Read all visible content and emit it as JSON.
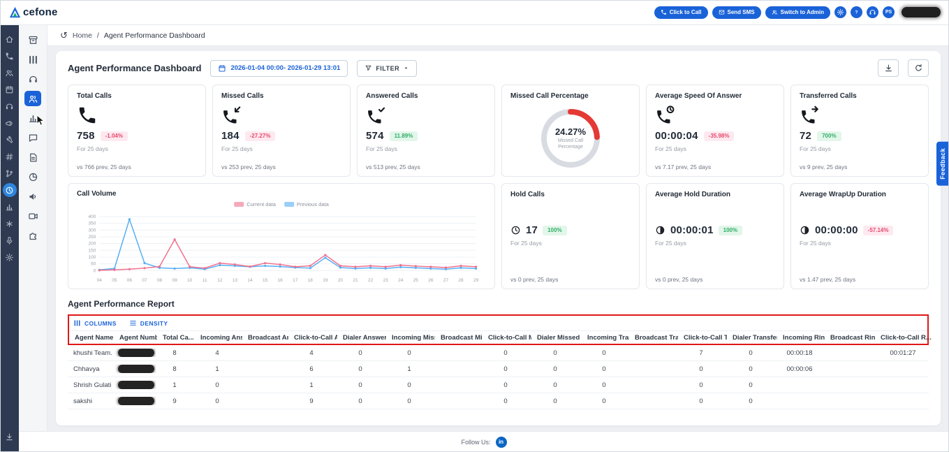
{
  "colors": {
    "accent_blue": "#1a62d8",
    "sidebar_dark": "#2d3a51",
    "positive_text": "#2fae68",
    "positive_bg": "#e2f6ea",
    "negative_text": "#e8486e",
    "negative_bg": "#fde9ef",
    "gauge_red": "#e53935",
    "gauge_track": "#d8dce2",
    "annotation_box": "#e01818",
    "linkedin_blue": "#0a66c2"
  },
  "topbar": {
    "logo_text": "cefone",
    "buttons": [
      {
        "name": "click-to-call",
        "label": "Click to Call",
        "icon": "phone"
      },
      {
        "name": "send-sms",
        "label": "Send SMS",
        "icon": "envelope"
      },
      {
        "name": "switch-to-admin",
        "label": "Switch to Admin",
        "icon": "users"
      }
    ],
    "icon_buttons": [
      {
        "name": "settings",
        "icon": "gear"
      },
      {
        "name": "help",
        "icon": "question"
      },
      {
        "name": "support-agent",
        "icon": "headset"
      }
    ],
    "avatar_initials": "PS",
    "redacted_info": true
  },
  "breadcrumb": {
    "items": [
      "Home",
      "Agent Performance Dashboard"
    ],
    "separator": "/"
  },
  "toolbar": {
    "title": "Agent Performance Dashboard",
    "date_range": "2026-01-04 00:00- 2026-01-29 13:01",
    "filter_label": "FILTER"
  },
  "sidebar_primary": {
    "items": [
      {
        "name": "home",
        "icon": "home"
      },
      {
        "name": "calls",
        "icon": "phone"
      },
      {
        "name": "contacts",
        "icon": "users"
      },
      {
        "name": "calendar",
        "icon": "calendar"
      },
      {
        "name": "call-center",
        "icon": "headset"
      },
      {
        "name": "campaigns",
        "icon": "megaphone"
      },
      {
        "name": "tools",
        "icon": "wrench"
      },
      {
        "name": "numbers",
        "icon": "hash"
      },
      {
        "name": "integrations",
        "icon": "branch"
      },
      {
        "name": "history",
        "icon": "history",
        "active": true
      },
      {
        "name": "analytics",
        "icon": "chart"
      },
      {
        "name": "services",
        "icon": "asterisk"
      },
      {
        "name": "recordings",
        "icon": "mic"
      },
      {
        "name": "settings",
        "icon": "gear"
      }
    ],
    "bottom": {
      "name": "download",
      "icon": "download"
    }
  },
  "sidebar_secondary": {
    "items": [
      {
        "name": "inbox",
        "icon": "archive"
      },
      {
        "name": "dashboard",
        "icon": "columns"
      },
      {
        "name": "calls",
        "icon": "headset"
      },
      {
        "name": "agents",
        "icon": "users",
        "active": true
      },
      {
        "name": "reports",
        "icon": "chart"
      },
      {
        "name": "chat",
        "icon": "chat"
      },
      {
        "name": "documents",
        "icon": "doc"
      },
      {
        "name": "analytics",
        "icon": "pie"
      },
      {
        "name": "announcements",
        "icon": "speaker"
      },
      {
        "name": "video",
        "icon": "camera"
      },
      {
        "name": "integrations",
        "icon": "puzzle"
      }
    ]
  },
  "kpis": [
    {
      "title": "Total Calls",
      "icon": "phone",
      "value": "758",
      "badge": "-1.04%",
      "badge_type": "negative",
      "period": "For 25 days",
      "comparison": "vs 766 prev, 25 days"
    },
    {
      "title": "Missed Calls",
      "icon": "phone-missed",
      "value": "184",
      "badge": "-27.27%",
      "badge_type": "negative",
      "period": "For 25 days",
      "comparison": "vs 253 prev, 25 days"
    },
    {
      "title": "Answered Calls",
      "icon": "phone-answered",
      "value": "574",
      "badge": "11.89%",
      "badge_type": "positive",
      "period": "For 25 days",
      "comparison": "vs 513 prev, 25 days"
    },
    {
      "type": "gauge",
      "title": "Missed Call Percentage",
      "value": "24.27%",
      "gauge_percent": 24.27,
      "label_lines": [
        "Missed Call",
        "Percentage"
      ]
    },
    {
      "title": "Average Speed Of Answer",
      "icon": "phone-clock",
      "value": "00:00:04",
      "badge": "-35.98%",
      "badge_type": "negative",
      "period": "For 25 days",
      "comparison": "vs 7.17 prev, 25 days"
    },
    {
      "title": "Transferred Calls",
      "icon": "phone-forward",
      "value": "72",
      "badge": "700%",
      "badge_type": "positive",
      "period": "For 25 days",
      "comparison": "vs 9 prev, 25 days"
    }
  ],
  "chart_data": {
    "type": "line",
    "title": "Call Volume",
    "x": [
      "04",
      "05",
      "06",
      "07",
      "08",
      "09",
      "10",
      "11",
      "12",
      "13",
      "14",
      "15",
      "16",
      "17",
      "18",
      "19",
      "20",
      "21",
      "22",
      "23",
      "24",
      "25",
      "26",
      "27",
      "28",
      "29"
    ],
    "series": [
      {
        "name": "Current data",
        "color": "#f0708d",
        "values": [
          2,
          5,
          10,
          18,
          30,
          230,
          28,
          18,
          55,
          45,
          30,
          55,
          45,
          28,
          35,
          115,
          35,
          28,
          35,
          28,
          40,
          33,
          28,
          22,
          35,
          28
        ]
      },
      {
        "name": "Previous data",
        "color": "#55aef3",
        "values": [
          5,
          15,
          380,
          55,
          20,
          15,
          20,
          10,
          40,
          35,
          28,
          35,
          30,
          22,
          18,
          95,
          22,
          15,
          20,
          15,
          25,
          20,
          15,
          10,
          20,
          15
        ]
      }
    ],
    "ylim": [
      0,
      400
    ],
    "yticks": [
      0,
      50,
      100,
      150,
      200,
      250,
      300,
      350,
      400
    ],
    "legend_position": "top-center",
    "grid": true
  },
  "kpis_row2": [
    {
      "title": "Hold Calls",
      "icon": "clock",
      "value": "17",
      "badge": "100%",
      "badge_type": "positive",
      "period": "For 25 days",
      "comparison": "vs 0 prev, 25 days"
    },
    {
      "title": "Average Hold Duration",
      "icon": "timer",
      "value": "00:00:01",
      "badge": "100%",
      "badge_type": "positive",
      "period": "For 25 days",
      "comparison": "vs 0 prev, 25 days"
    },
    {
      "title": "Average WrapUp Duration",
      "icon": "timer",
      "value": "00:00:00",
      "badge": "-57.14%",
      "badge_type": "negative",
      "period": "For 25 days",
      "comparison": "vs 1.47 prev, 25 days"
    }
  ],
  "report": {
    "title": "Agent Performance Report",
    "toolbar": {
      "columns_label": "COLUMNS",
      "density_label": "DENSITY"
    },
    "columns": [
      "Agent Name",
      "Agent Numb...",
      "Total Ca...",
      "Incoming Answ...",
      "Broadcast Ans...",
      "Click-to-Call A...",
      "Dialer Answere...",
      "Incoming Misse...",
      "Broadcast Miss...",
      "Click-to-Call M...",
      "Dialer Missed C...",
      "Incoming Trans...",
      "Broadcast Tran...",
      "Click-to-Call Tr...",
      "Dialer Transferr...",
      "Incoming Ring ...",
      "Broadcast Ring...",
      "Click-to-Call R..."
    ],
    "rows": [
      {
        "name": "khushi Team..",
        "number_redacted": true,
        "values": [
          "8",
          "4",
          "",
          "4",
          "0",
          "0",
          "",
          "0",
          "0",
          "0",
          "",
          "7",
          "0",
          "00:00:18",
          "",
          "00:01:27"
        ]
      },
      {
        "name": "Chhavya",
        "number_redacted": true,
        "values": [
          "8",
          "1",
          "",
          "6",
          "0",
          "1",
          "",
          "0",
          "0",
          "0",
          "",
          "0",
          "0",
          "00:00:06",
          "",
          ""
        ]
      },
      {
        "name": "Shrish Gulati",
        "number_redacted": true,
        "values": [
          "1",
          "0",
          "",
          "1",
          "0",
          "0",
          "",
          "0",
          "0",
          "0",
          "",
          "0",
          "0",
          "",
          "",
          ""
        ]
      },
      {
        "name": "sakshi",
        "number_redacted": true,
        "values": [
          "9",
          "0",
          "",
          "9",
          "0",
          "0",
          "",
          "0",
          "0",
          "0",
          "",
          "0",
          "0",
          "",
          "",
          ""
        ]
      }
    ]
  },
  "footer": {
    "label": "Follow Us:",
    "social": "linkedin",
    "linkedin_glyph": "in"
  },
  "feedback_label": "Feedback"
}
